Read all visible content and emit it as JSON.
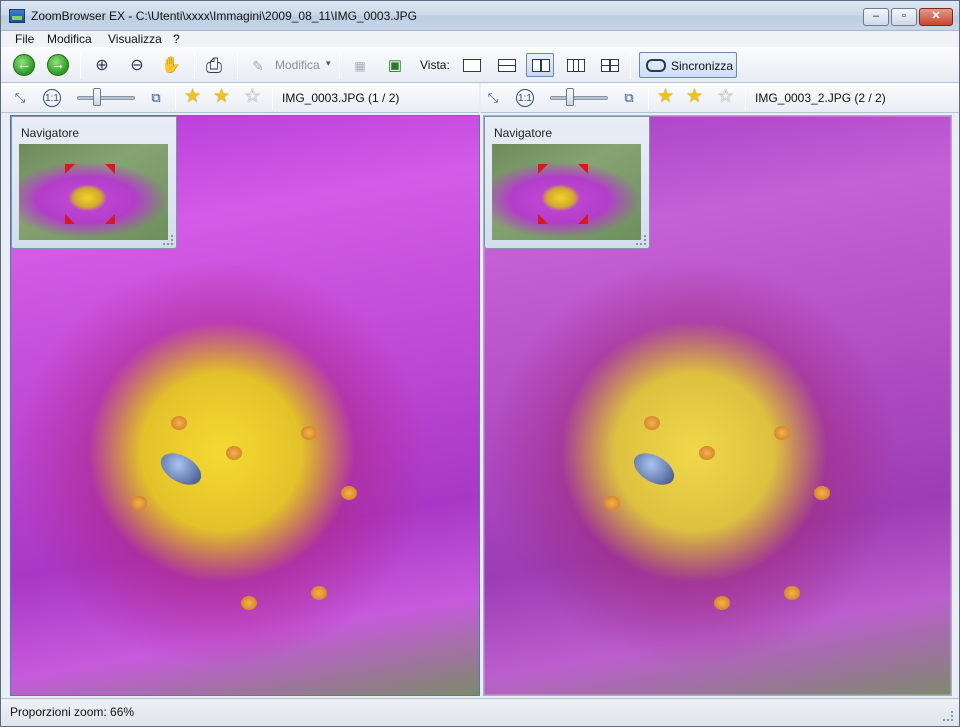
{
  "window": {
    "title": "ZoomBrowser EX - C:\\Utenti\\xxxx\\Immagini\\2009_08_11\\IMG_0003.JPG",
    "controls": {
      "minimize": "–",
      "maximize": "▫",
      "close": "✕"
    }
  },
  "menu": {
    "items": [
      "File",
      "Modifica",
      "Visualizza",
      "?"
    ]
  },
  "toolbar": {
    "back": "←",
    "forward": "→",
    "zoom_in": "⊕",
    "zoom_out": "⊖",
    "hand": "✋",
    "print": "⎙",
    "modifica_label": "Modifica",
    "modifica_caret": "▾",
    "vista_label": "Vista:",
    "sync_label": "Sincronizza",
    "active_view": "side-by-side-vertical"
  },
  "panes": [
    {
      "filename": "IMG_0003.JPG (1 / 2)",
      "rating_on": 2,
      "rating_total": 3,
      "navigator_title": "Navigatore",
      "zoom_slider": 0.35
    },
    {
      "filename": "IMG_0003_2.JPG (2 / 2)",
      "rating_on": 2,
      "rating_total": 3,
      "navigator_title": "Navigatore",
      "zoom_slider": 0.35
    }
  ],
  "stars": {
    "on": "★",
    "off": "☆"
  },
  "status": {
    "text": "Proporzioni zoom: 66%"
  },
  "colors": {
    "accent_blue": "#4d79c0",
    "star_yellow": "#f0c21a",
    "green_arrow": "#2c9a23",
    "nav_marker_red": "#d7181e"
  }
}
